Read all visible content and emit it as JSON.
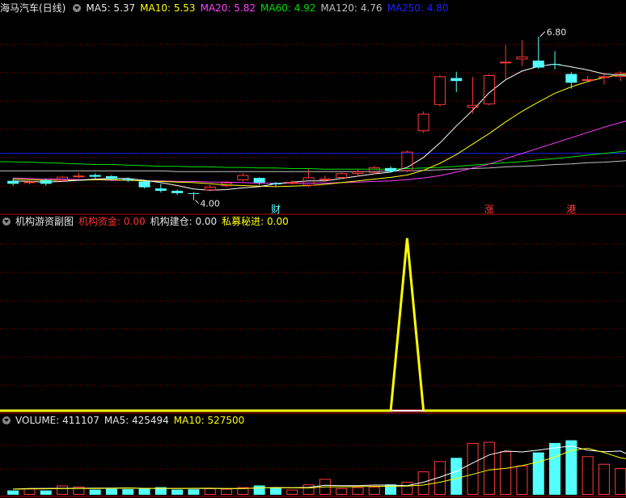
{
  "main_header": {
    "title": "海马汽车(日线)",
    "ma5": "MA5: 5.37",
    "ma10": "MA10: 5.53",
    "ma20": "MA20: 5.82",
    "ma60": "MA60: 4.92",
    "ma120": "MA120: 4.76",
    "ma250": "MA250: 4.80"
  },
  "indicator_header": {
    "title": "机构游资副图",
    "inst_fund": "机构资金: 0.00",
    "inst_build": "机构建仓: 0.00",
    "private_in": "私募秘进: 0.00"
  },
  "volume_header": {
    "volume": "VOLUME: 411107",
    "ma5": "MA5: 425494",
    "ma10": "MA10: 527500"
  },
  "colors": {
    "up": "#ff3c3c",
    "down": "#54ffff",
    "ma5": "#ffffff",
    "ma10": "#ffff00",
    "ma20": "#ff40ff",
    "ma60": "#00e000",
    "ma120": "#c0c0c0",
    "ma250": "#2020ff",
    "grid": "#8b0000"
  },
  "chart_data": [
    {
      "type": "candlestick",
      "title": "海马汽车(日线)",
      "ylim": [
        3.8,
        7.15
      ],
      "annotations": [
        {
          "text": "6.80",
          "x": 32,
          "y": 6.8
        },
        {
          "text": "4.00",
          "x": 11,
          "y": 4.0
        }
      ],
      "event_markers": [
        {
          "text": "财",
          "x": 16
        },
        {
          "text": "涨",
          "x": 29
        },
        {
          "text": "港",
          "x": 34
        }
      ],
      "candles": [
        {
          "o": 4.33,
          "c": 4.28,
          "h": 4.37,
          "l": 4.25
        },
        {
          "o": 4.3,
          "c": 4.32,
          "h": 4.35,
          "l": 4.27
        },
        {
          "o": 4.34,
          "c": 4.28,
          "h": 4.37,
          "l": 4.25
        },
        {
          "o": 4.33,
          "c": 4.4,
          "h": 4.42,
          "l": 4.31
        },
        {
          "o": 4.4,
          "c": 4.42,
          "h": 4.47,
          "l": 4.37
        },
        {
          "o": 4.43,
          "c": 4.4,
          "h": 4.46,
          "l": 4.37
        },
        {
          "o": 4.41,
          "c": 4.36,
          "h": 4.43,
          "l": 4.33
        },
        {
          "o": 4.36,
          "c": 4.34,
          "h": 4.39,
          "l": 4.31
        },
        {
          "o": 4.32,
          "c": 4.22,
          "h": 4.33,
          "l": 4.2
        },
        {
          "o": 4.2,
          "c": 4.16,
          "h": 4.28,
          "l": 4.13
        },
        {
          "o": 4.16,
          "c": 4.12,
          "h": 4.18,
          "l": 4.09
        },
        {
          "o": 4.12,
          "c": 4.11,
          "h": 4.14,
          "l": 4.0
        },
        {
          "o": 4.17,
          "c": 4.23,
          "h": 4.26,
          "l": 4.15
        },
        {
          "o": 4.24,
          "c": 4.3,
          "h": 4.33,
          "l": 4.22
        },
        {
          "o": 4.34,
          "c": 4.43,
          "h": 4.46,
          "l": 4.32
        },
        {
          "o": 4.38,
          "c": 4.3,
          "h": 4.39,
          "l": 4.26
        },
        {
          "o": 4.29,
          "c": 4.27,
          "h": 4.31,
          "l": 4.24
        },
        {
          "o": 4.29,
          "c": 4.31,
          "h": 4.34,
          "l": 4.27
        },
        {
          "o": 4.25,
          "c": 4.39,
          "h": 4.53,
          "l": 4.22
        },
        {
          "o": 4.34,
          "c": 4.37,
          "h": 4.42,
          "l": 4.31
        },
        {
          "o": 4.38,
          "c": 4.46,
          "h": 4.48,
          "l": 4.36
        },
        {
          "o": 4.45,
          "c": 4.49,
          "h": 4.52,
          "l": 4.4
        },
        {
          "o": 4.47,
          "c": 4.56,
          "h": 4.59,
          "l": 4.44
        },
        {
          "o": 4.55,
          "c": 4.49,
          "h": 4.58,
          "l": 4.47
        },
        {
          "o": 4.5,
          "c": 4.83,
          "h": 4.85,
          "l": 4.48
        },
        {
          "o": 5.18,
          "c": 5.48,
          "h": 5.52,
          "l": 5.15
        },
        {
          "o": 5.63,
          "c": 6.12,
          "h": 6.14,
          "l": 5.6
        },
        {
          "o": 6.09,
          "c": 6.04,
          "h": 6.2,
          "l": 5.85
        },
        {
          "o": 5.58,
          "c": 5.63,
          "h": 6.11,
          "l": 5.48
        },
        {
          "o": 5.64,
          "c": 6.14,
          "h": 6.16,
          "l": 5.62
        },
        {
          "o": 6.37,
          "c": 6.37,
          "h": 6.66,
          "l": 6.08
        },
        {
          "o": 6.41,
          "c": 6.46,
          "h": 6.74,
          "l": 6.3
        },
        {
          "o": 6.39,
          "c": 6.27,
          "h": 6.8,
          "l": 6.25
        },
        {
          "o": 6.33,
          "c": 6.32,
          "h": 6.55,
          "l": 6.24
        },
        {
          "o": 6.16,
          "c": 6.01,
          "h": 6.19,
          "l": 5.91
        },
        {
          "o": 6.06,
          "c": 6.07,
          "h": 6.13,
          "l": 6.01
        },
        {
          "o": 6.11,
          "c": 6.12,
          "h": 6.15,
          "l": 5.98
        },
        {
          "o": 6.11,
          "c": 6.18,
          "h": 6.21,
          "l": 6.04
        },
        {
          "o": 6.0,
          "c": 6.27,
          "h": 6.55,
          "l": 5.96
        }
      ],
      "series": [
        {
          "name": "MA5",
          "color": "#ffffff",
          "values": [
            4.33,
            4.32,
            4.31,
            4.32,
            4.34,
            4.36,
            4.37,
            4.37,
            4.34,
            4.3,
            4.25,
            4.19,
            4.17,
            4.18,
            4.21,
            4.23,
            4.28,
            4.31,
            4.33,
            4.33,
            4.37,
            4.41,
            4.45,
            4.48,
            4.56,
            4.73,
            4.98,
            5.27,
            5.54,
            5.84,
            6.06,
            6.21,
            6.29,
            6.33,
            6.28,
            6.23,
            6.16,
            6.14,
            6.13
          ]
        },
        {
          "name": "MA10",
          "color": "#ffff00",
          "values": [
            4.36,
            4.35,
            4.34,
            4.34,
            4.34,
            4.35,
            4.35,
            4.34,
            4.33,
            4.32,
            4.31,
            4.3,
            4.28,
            4.26,
            4.25,
            4.24,
            4.23,
            4.24,
            4.25,
            4.27,
            4.3,
            4.33,
            4.36,
            4.39,
            4.43,
            4.51,
            4.63,
            4.78,
            4.96,
            5.14,
            5.34,
            5.52,
            5.68,
            5.83,
            5.94,
            6.03,
            6.1,
            6.15,
            6.15
          ]
        },
        {
          "name": "MA20",
          "color": "#ff40ff",
          "values": [
            4.38,
            4.37,
            4.36,
            4.36,
            4.35,
            4.35,
            4.34,
            4.34,
            4.33,
            4.33,
            4.32,
            4.32,
            4.31,
            4.31,
            4.3,
            4.29,
            4.29,
            4.29,
            4.29,
            4.29,
            4.3,
            4.31,
            4.32,
            4.33,
            4.35,
            4.38,
            4.42,
            4.48,
            4.55,
            4.62,
            4.71,
            4.8,
            4.89,
            4.98,
            5.07,
            5.16,
            5.25,
            5.33,
            5.4
          ]
        },
        {
          "name": "MA60",
          "color": "#00e000",
          "values": [
            4.66,
            4.65,
            4.64,
            4.63,
            4.62,
            4.61,
            4.61,
            4.6,
            4.59,
            4.58,
            4.58,
            4.57,
            4.57,
            4.56,
            4.56,
            4.55,
            4.55,
            4.54,
            4.54,
            4.53,
            4.53,
            4.53,
            4.53,
            4.53,
            4.54,
            4.55,
            4.56,
            4.58,
            4.6,
            4.62,
            4.64,
            4.66,
            4.69,
            4.71,
            4.74,
            4.77,
            4.8,
            4.83,
            4.86
          ]
        },
        {
          "name": "MA120",
          "color": "#c0c0c0",
          "values": [
            4.5,
            4.5,
            4.5,
            4.5,
            4.5,
            4.5,
            4.5,
            4.5,
            4.5,
            4.5,
            4.49,
            4.49,
            4.49,
            4.49,
            4.49,
            4.49,
            4.49,
            4.49,
            4.49,
            4.49,
            4.49,
            4.49,
            4.49,
            4.5,
            4.5,
            4.51,
            4.52,
            4.53,
            4.54,
            4.55,
            4.57,
            4.58,
            4.59,
            4.61,
            4.62,
            4.64,
            4.65,
            4.67,
            4.69
          ]
        },
        {
          "name": "MA250",
          "color": "#2020ff",
          "values": [
            4.8,
            4.8,
            4.8,
            4.8,
            4.8,
            4.8,
            4.8,
            4.8,
            4.8,
            4.8,
            4.8,
            4.8,
            4.8,
            4.8,
            4.8,
            4.8,
            4.8,
            4.8,
            4.8,
            4.8,
            4.8,
            4.8,
            4.8,
            4.8,
            4.8,
            4.8,
            4.8,
            4.8,
            4.8,
            4.8,
            4.8,
            4.8,
            4.8,
            4.8,
            4.8,
            4.8,
            4.8,
            4.8,
            4.8
          ]
        }
      ]
    },
    {
      "type": "line",
      "title": "机构游资副图",
      "ylim": [
        0,
        1.05
      ],
      "series": [
        {
          "name": "机构资金",
          "color": "#ff3030",
          "values": [
            0,
            0,
            0,
            0,
            0,
            0,
            0,
            0,
            0,
            0,
            0,
            0,
            0,
            0,
            0,
            0,
            0,
            0,
            0,
            0,
            0,
            0,
            0,
            0,
            0,
            0,
            0,
            0,
            0,
            0,
            0,
            0,
            0,
            0,
            0,
            0,
            0,
            0,
            0
          ]
        },
        {
          "name": "私募秘进",
          "color": "#ffff00",
          "values": [
            0,
            0,
            0,
            0,
            0,
            0,
            0,
            0,
            0,
            0,
            0,
            0,
            0,
            0,
            0,
            0,
            0,
            0,
            0,
            0,
            0,
            0,
            0,
            0,
            1,
            0,
            0,
            0,
            0,
            0,
            0,
            0,
            0,
            0,
            0,
            0,
            0,
            0,
            0
          ]
        }
      ]
    },
    {
      "type": "bar",
      "title": "VOLUME",
      "ylim": [
        0,
        1500000
      ],
      "values": [
        98000,
        148000,
        98000,
        209000,
        184000,
        117000,
        135000,
        127000,
        148000,
        172000,
        117000,
        123000,
        148000,
        135000,
        172000,
        210000,
        160000,
        117000,
        234000,
        359000,
        148000,
        172000,
        184000,
        234000,
        294000,
        528000,
        761000,
        835000,
        1172000,
        1197000,
        982000,
        662000,
        958000,
        1172000,
        1233000,
        872000,
        700000,
        602000,
        405000
      ],
      "series": [
        {
          "name": "MA5",
          "color": "#ffffff",
          "values": [
            130000,
            140000,
            145000,
            147000,
            147000,
            151000,
            152000,
            156000,
            144000,
            140000,
            140000,
            141000,
            141000,
            139000,
            139000,
            156000,
            165000,
            161000,
            166000,
            216000,
            204000,
            206000,
            219000,
            219000,
            206000,
            283000,
            400000,
            531000,
            718000,
            902000,
            989000,
            970000,
            1012000,
            1061000,
            1102000,
            1008000,
            973000,
            989000,
            815000
          ]
        },
        {
          "name": "MA10",
          "color": "#ffff00",
          "values": [
            128000,
            132000,
            135000,
            139000,
            141000,
            143000,
            146000,
            151000,
            146000,
            144000,
            145000,
            146000,
            148000,
            143000,
            143000,
            155000,
            157000,
            158000,
            154000,
            177000,
            180000,
            185000,
            190000,
            193000,
            198000,
            219000,
            284000,
            367000,
            462000,
            563000,
            597000,
            658000,
            745000,
            851000,
            1002000,
            1052000,
            955000,
            835000,
            788000
          ]
        }
      ]
    }
  ]
}
